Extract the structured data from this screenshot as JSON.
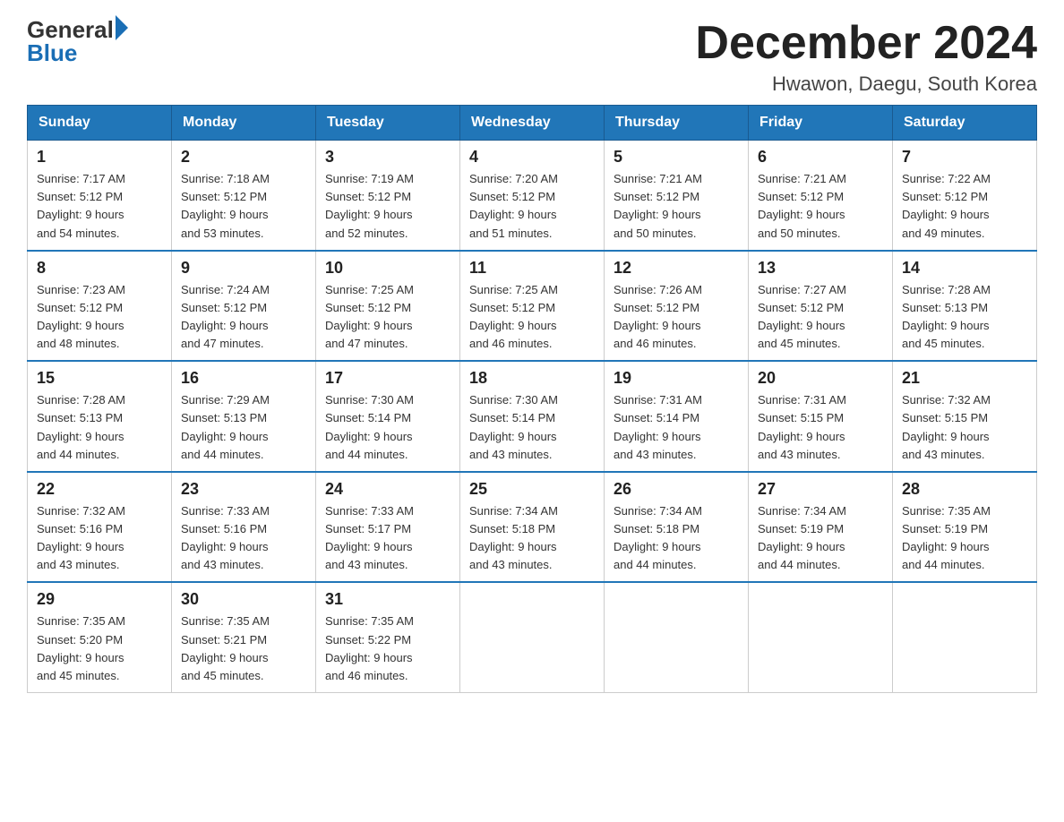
{
  "header": {
    "logo_general": "General",
    "logo_blue": "Blue",
    "month_title": "December 2024",
    "location": "Hwawon, Daegu, South Korea"
  },
  "weekdays": [
    "Sunday",
    "Monday",
    "Tuesday",
    "Wednesday",
    "Thursday",
    "Friday",
    "Saturday"
  ],
  "weeks": [
    [
      {
        "day": "1",
        "sunrise": "7:17 AM",
        "sunset": "5:12 PM",
        "daylight": "9 hours and 54 minutes."
      },
      {
        "day": "2",
        "sunrise": "7:18 AM",
        "sunset": "5:12 PM",
        "daylight": "9 hours and 53 minutes."
      },
      {
        "day": "3",
        "sunrise": "7:19 AM",
        "sunset": "5:12 PM",
        "daylight": "9 hours and 52 minutes."
      },
      {
        "day": "4",
        "sunrise": "7:20 AM",
        "sunset": "5:12 PM",
        "daylight": "9 hours and 51 minutes."
      },
      {
        "day": "5",
        "sunrise": "7:21 AM",
        "sunset": "5:12 PM",
        "daylight": "9 hours and 50 minutes."
      },
      {
        "day": "6",
        "sunrise": "7:21 AM",
        "sunset": "5:12 PM",
        "daylight": "9 hours and 50 minutes."
      },
      {
        "day": "7",
        "sunrise": "7:22 AM",
        "sunset": "5:12 PM",
        "daylight": "9 hours and 49 minutes."
      }
    ],
    [
      {
        "day": "8",
        "sunrise": "7:23 AM",
        "sunset": "5:12 PM",
        "daylight": "9 hours and 48 minutes."
      },
      {
        "day": "9",
        "sunrise": "7:24 AM",
        "sunset": "5:12 PM",
        "daylight": "9 hours and 47 minutes."
      },
      {
        "day": "10",
        "sunrise": "7:25 AM",
        "sunset": "5:12 PM",
        "daylight": "9 hours and 47 minutes."
      },
      {
        "day": "11",
        "sunrise": "7:25 AM",
        "sunset": "5:12 PM",
        "daylight": "9 hours and 46 minutes."
      },
      {
        "day": "12",
        "sunrise": "7:26 AM",
        "sunset": "5:12 PM",
        "daylight": "9 hours and 46 minutes."
      },
      {
        "day": "13",
        "sunrise": "7:27 AM",
        "sunset": "5:12 PM",
        "daylight": "9 hours and 45 minutes."
      },
      {
        "day": "14",
        "sunrise": "7:28 AM",
        "sunset": "5:13 PM",
        "daylight": "9 hours and 45 minutes."
      }
    ],
    [
      {
        "day": "15",
        "sunrise": "7:28 AM",
        "sunset": "5:13 PM",
        "daylight": "9 hours and 44 minutes."
      },
      {
        "day": "16",
        "sunrise": "7:29 AM",
        "sunset": "5:13 PM",
        "daylight": "9 hours and 44 minutes."
      },
      {
        "day": "17",
        "sunrise": "7:30 AM",
        "sunset": "5:14 PM",
        "daylight": "9 hours and 44 minutes."
      },
      {
        "day": "18",
        "sunrise": "7:30 AM",
        "sunset": "5:14 PM",
        "daylight": "9 hours and 43 minutes."
      },
      {
        "day": "19",
        "sunrise": "7:31 AM",
        "sunset": "5:14 PM",
        "daylight": "9 hours and 43 minutes."
      },
      {
        "day": "20",
        "sunrise": "7:31 AM",
        "sunset": "5:15 PM",
        "daylight": "9 hours and 43 minutes."
      },
      {
        "day": "21",
        "sunrise": "7:32 AM",
        "sunset": "5:15 PM",
        "daylight": "9 hours and 43 minutes."
      }
    ],
    [
      {
        "day": "22",
        "sunrise": "7:32 AM",
        "sunset": "5:16 PM",
        "daylight": "9 hours and 43 minutes."
      },
      {
        "day": "23",
        "sunrise": "7:33 AM",
        "sunset": "5:16 PM",
        "daylight": "9 hours and 43 minutes."
      },
      {
        "day": "24",
        "sunrise": "7:33 AM",
        "sunset": "5:17 PM",
        "daylight": "9 hours and 43 minutes."
      },
      {
        "day": "25",
        "sunrise": "7:34 AM",
        "sunset": "5:18 PM",
        "daylight": "9 hours and 43 minutes."
      },
      {
        "day": "26",
        "sunrise": "7:34 AM",
        "sunset": "5:18 PM",
        "daylight": "9 hours and 44 minutes."
      },
      {
        "day": "27",
        "sunrise": "7:34 AM",
        "sunset": "5:19 PM",
        "daylight": "9 hours and 44 minutes."
      },
      {
        "day": "28",
        "sunrise": "7:35 AM",
        "sunset": "5:19 PM",
        "daylight": "9 hours and 44 minutes."
      }
    ],
    [
      {
        "day": "29",
        "sunrise": "7:35 AM",
        "sunset": "5:20 PM",
        "daylight": "9 hours and 45 minutes."
      },
      {
        "day": "30",
        "sunrise": "7:35 AM",
        "sunset": "5:21 PM",
        "daylight": "9 hours and 45 minutes."
      },
      {
        "day": "31",
        "sunrise": "7:35 AM",
        "sunset": "5:22 PM",
        "daylight": "9 hours and 46 minutes."
      },
      null,
      null,
      null,
      null
    ]
  ],
  "labels": {
    "sunrise_prefix": "Sunrise: ",
    "sunset_prefix": "Sunset: ",
    "daylight_prefix": "Daylight: "
  }
}
